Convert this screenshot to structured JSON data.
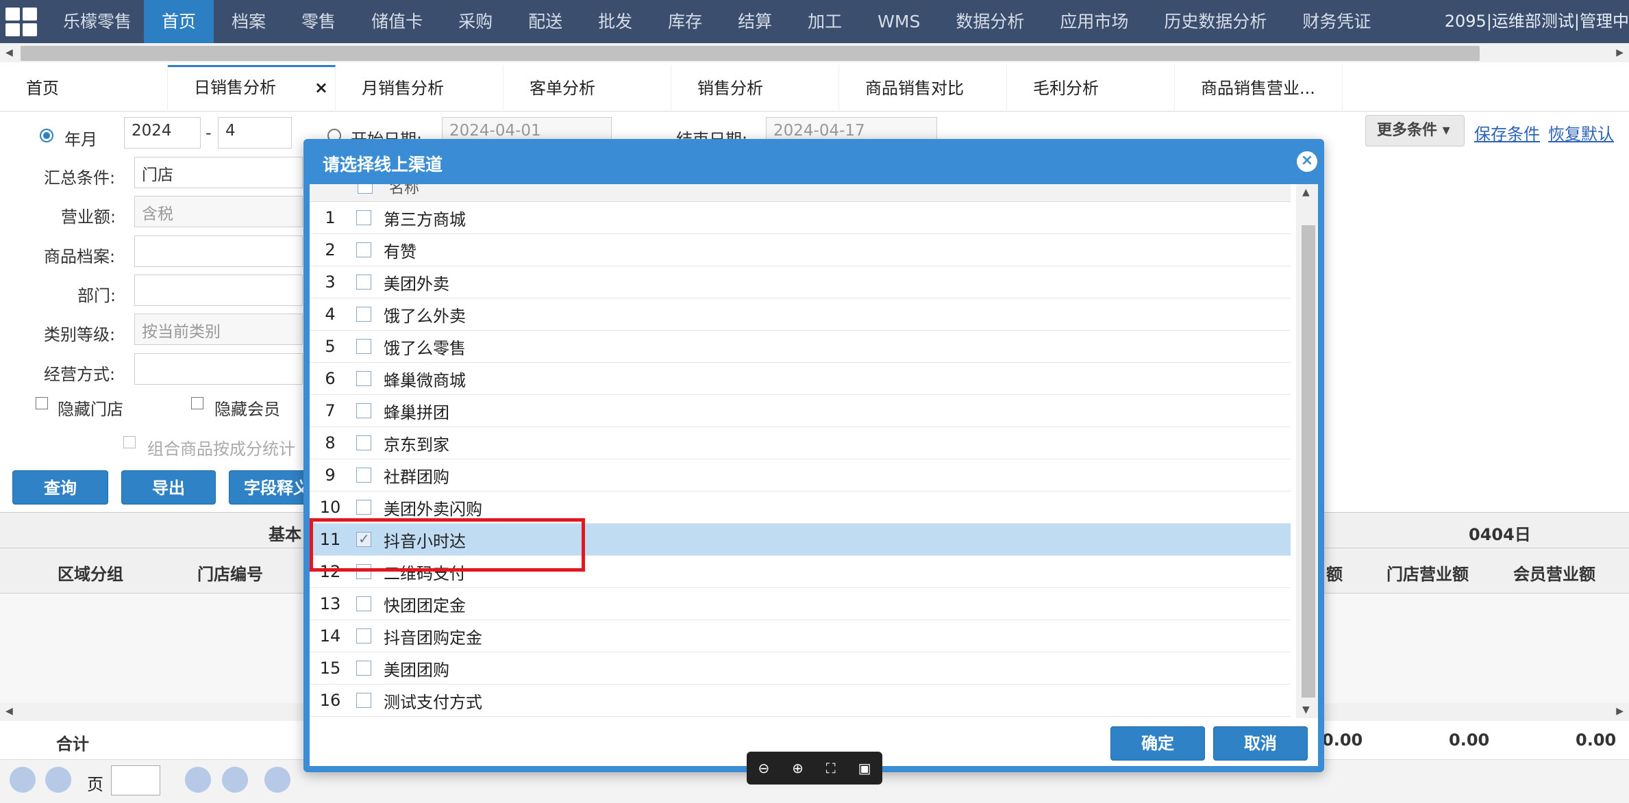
{
  "topnav": {
    "brand": "乐檬零售",
    "items": [
      "首页",
      "档案",
      "零售",
      "储值卡",
      "采购",
      "配送",
      "批发",
      "库存",
      "结算",
      "加工",
      "WMS",
      "数据分析",
      "应用市场",
      "历史数据分析",
      "财务凭证"
    ],
    "active_index": 0,
    "user": "2095|运维部测试|管理中"
  },
  "tabs": {
    "items": [
      "首页",
      "日销售分析",
      "月销售分析",
      "客单分析",
      "销售分析",
      "商品销售对比",
      "毛利分析",
      "商品销售营业..."
    ],
    "active_index": 1,
    "close": "×"
  },
  "form": {
    "year_month_label": "年月",
    "year": "2024",
    "month": "4",
    "dash": "-",
    "start_date_label": "开始日期:",
    "start_date": "2024-04-01",
    "end_date_label": "结束日期:",
    "end_date": "2024-04-17",
    "summary_label": "汇总条件:",
    "summary_value": "门店",
    "revenue_label": "营业额:",
    "revenue_value": "含税",
    "product_label": "商品档案:",
    "dept_label": "部门:",
    "category_label": "类别等级:",
    "category_value": "按当前类别",
    "business_label": "经营方式:",
    "hide_store": "隐藏门店",
    "hide_member": "隐藏会员",
    "combo": "组合商品按成分统计",
    "query_btn": "查询",
    "export_btn": "导出",
    "field_btn": "字段释义",
    "more_btn": "更多条件",
    "save_link": "保存条件",
    "restore_link": "恢复默认"
  },
  "table": {
    "group_basic": "基本",
    "group_date": "0404日",
    "col_region": "区域分组",
    "col_store_no": "门店编号",
    "col_amount": "额",
    "col_store_rev": "门店营业额",
    "col_member_rev": "会员营业额",
    "total_label": "合计",
    "totals": [
      "0.00",
      "0.00",
      "0.00"
    ],
    "page_label": "页"
  },
  "modal": {
    "title": "请选择线上渠道",
    "header_name": "名称",
    "channels": [
      {
        "num": "1",
        "name": "第三方商城",
        "checked": false
      },
      {
        "num": "2",
        "name": "有赞",
        "checked": false
      },
      {
        "num": "3",
        "name": "美团外卖",
        "checked": false
      },
      {
        "num": "4",
        "name": "饿了么外卖",
        "checked": false
      },
      {
        "num": "5",
        "name": "饿了么零售",
        "checked": false
      },
      {
        "num": "6",
        "name": "蜂巢微商城",
        "checked": false
      },
      {
        "num": "7",
        "name": "蜂巢拼团",
        "checked": false
      },
      {
        "num": "8",
        "name": "京东到家",
        "checked": false
      },
      {
        "num": "9",
        "name": "社群团购",
        "checked": false
      },
      {
        "num": "10",
        "name": "美团外卖闪购",
        "checked": false
      },
      {
        "num": "11",
        "name": "抖音小时达",
        "checked": true
      },
      {
        "num": "12",
        "name": "二维码支付",
        "checked": false
      },
      {
        "num": "13",
        "name": "快团团定金",
        "checked": false
      },
      {
        "num": "14",
        "name": "抖音团购定金",
        "checked": false
      },
      {
        "num": "15",
        "name": "美团团购",
        "checked": false
      },
      {
        "num": "16",
        "name": "测试支付方式",
        "checked": false
      }
    ],
    "selected_index": 10,
    "confirm": "确定",
    "cancel": "取消"
  },
  "colors": {
    "nav_bg": "#3c4e6e",
    "accent": "#2c7fc3",
    "modal_bg": "#3a8dd4",
    "selected_row": "#bfdcf2",
    "highlight_box": "#e4161f"
  }
}
